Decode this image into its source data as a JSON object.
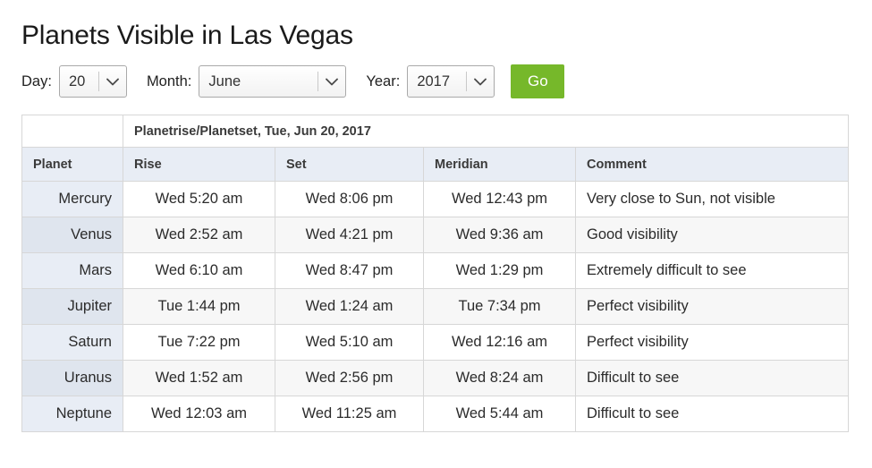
{
  "page": {
    "title": "Planets Visible in Las Vegas"
  },
  "form": {
    "day_label": "Day:",
    "day_value": "20",
    "month_label": "Month:",
    "month_value": "June",
    "year_label": "Year:",
    "year_value": "2017",
    "go_label": "Go",
    "dropdown_icon": "chevron-down-icon"
  },
  "table": {
    "span_title": "Planetrise/Planetset, Tue, Jun 20, 2017",
    "columns": [
      "Planet",
      "Rise",
      "Set",
      "Meridian",
      "Comment"
    ],
    "rows": [
      {
        "planet": "Mercury",
        "rise": "Wed 5:20 am",
        "set": "Wed 8:06 pm",
        "meridian": "Wed 12:43 pm",
        "comment": "Very close to Sun, not visible"
      },
      {
        "planet": "Venus",
        "rise": "Wed 2:52 am",
        "set": "Wed 4:21 pm",
        "meridian": "Wed 9:36 am",
        "comment": "Good visibility"
      },
      {
        "planet": "Mars",
        "rise": "Wed 6:10 am",
        "set": "Wed 8:47 pm",
        "meridian": "Wed 1:29 pm",
        "comment": "Extremely difficult to see"
      },
      {
        "planet": "Jupiter",
        "rise": "Tue 1:44 pm",
        "set": "Wed 1:24 am",
        "meridian": "Tue 7:34 pm",
        "comment": "Perfect visibility"
      },
      {
        "planet": "Saturn",
        "rise": "Tue 7:22 pm",
        "set": "Wed 5:10 am",
        "meridian": "Wed 12:16 am",
        "comment": "Perfect visibility"
      },
      {
        "planet": "Uranus",
        "rise": "Wed 1:52 am",
        "set": "Wed 2:56 pm",
        "meridian": "Wed 8:24 am",
        "comment": "Difficult to see"
      },
      {
        "planet": "Neptune",
        "rise": "Wed 12:03 am",
        "set": "Wed 11:25 am",
        "meridian": "Wed 5:44 am",
        "comment": "Difficult to see"
      }
    ]
  },
  "colors": {
    "go_button": "#76b82a",
    "header_background": "#e8edf5",
    "planet_column_odd": "#e8edf5",
    "planet_column_even": "#dfe5ee",
    "row_stripe": "#f7f7f7",
    "border": "#d7d7d7"
  }
}
